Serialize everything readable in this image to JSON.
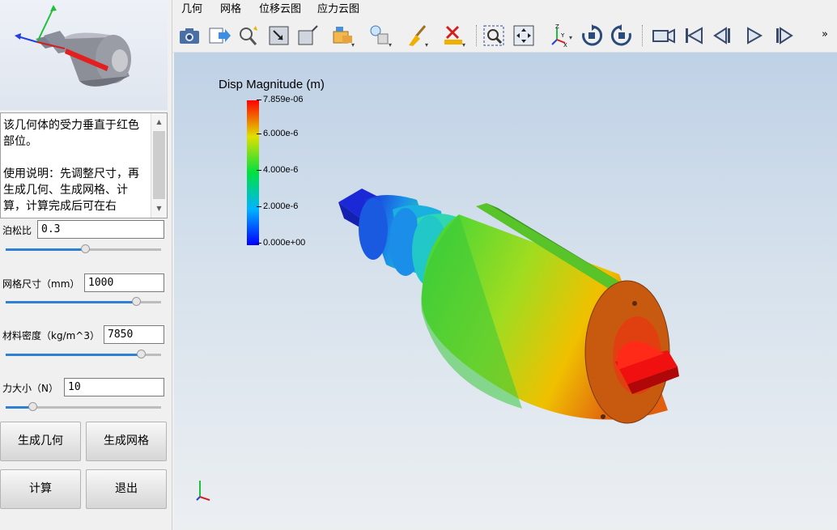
{
  "left_panel": {
    "description": "该几何体的受力垂直于红色部位。\n\n使用说明：先调整尺寸，再生成几何、生成网格、计算，计算完成后可在右",
    "params": [
      {
        "label": "泊松比",
        "value": "0.3",
        "slider": 0.51
      },
      {
        "label": "网格尺寸（mm）",
        "value": "1000",
        "slider": 0.84
      },
      {
        "label": "材料密度（kg/m^3）",
        "value": "7850",
        "slider": 0.87
      },
      {
        "label": "力大小（N）",
        "value": "10",
        "slider": 0.17
      }
    ],
    "buttons": {
      "gen_geometry": "生成几何",
      "gen_mesh": "生成网格",
      "compute": "计算",
      "exit": "退出"
    }
  },
  "tabs": [
    "几何",
    "网格",
    "位移云图",
    "应力云图"
  ],
  "toolbar": {
    "icons": [
      "camera-icon",
      "export-icon",
      "zoom-magic-icon",
      "view-fit-icon",
      "view-box-icon",
      "open-folder-icon",
      "light-icon",
      "clear-brush-icon",
      "delete-mesh-icon",
      "zoom-box-icon",
      "fit-all-icon",
      "axes-icon",
      "rotate-cw-icon",
      "rotate-ccw-icon",
      "video-icon",
      "first-frame-icon",
      "prev-frame-icon",
      "play-icon",
      "next-frame-icon"
    ],
    "overflow": "»"
  },
  "legend": {
    "title": "Disp Magnitude (m)",
    "ticks": [
      "7.859e-06",
      "6.000e-6",
      "4.000e-6",
      "2.000e-6",
      "0.000e+00"
    ]
  }
}
